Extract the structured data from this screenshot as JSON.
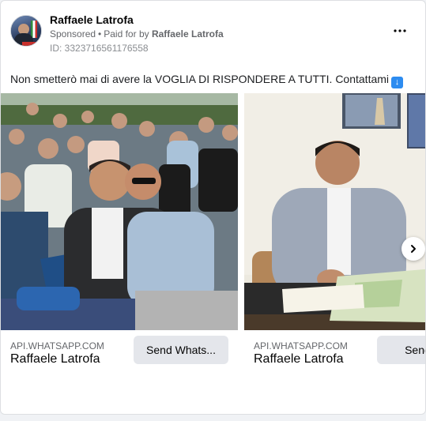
{
  "advertiser": {
    "name": "Raffaele Latrofa",
    "sponsored": "Sponsored",
    "paid_for_prefix": "Paid for by",
    "payer": "Raffaele Latrofa",
    "ad_id": "ID: 3323716561176558"
  },
  "post": {
    "text": "Non smetterò mai di avere la VOGLIA DI RISPONDERE A TUTTI. Contattami",
    "emoji": "down-arrow-emoji"
  },
  "carousel": {
    "cards": [
      {
        "domain": "API.WHATSAPP.COM",
        "headline": "Raffaele Latrofa",
        "cta": "Send Whats..."
      },
      {
        "domain": "API.WHATSAPP.COM",
        "headline": "Raffaele Latrofa",
        "cta": "Send W"
      }
    ],
    "next_icon": "chevron-right-icon"
  },
  "menu_icon": "more-horizontal-icon",
  "colors": {
    "secondary_text": "#65676b",
    "button_bg": "#e4e6eb",
    "card_border": "#dddfe2"
  }
}
